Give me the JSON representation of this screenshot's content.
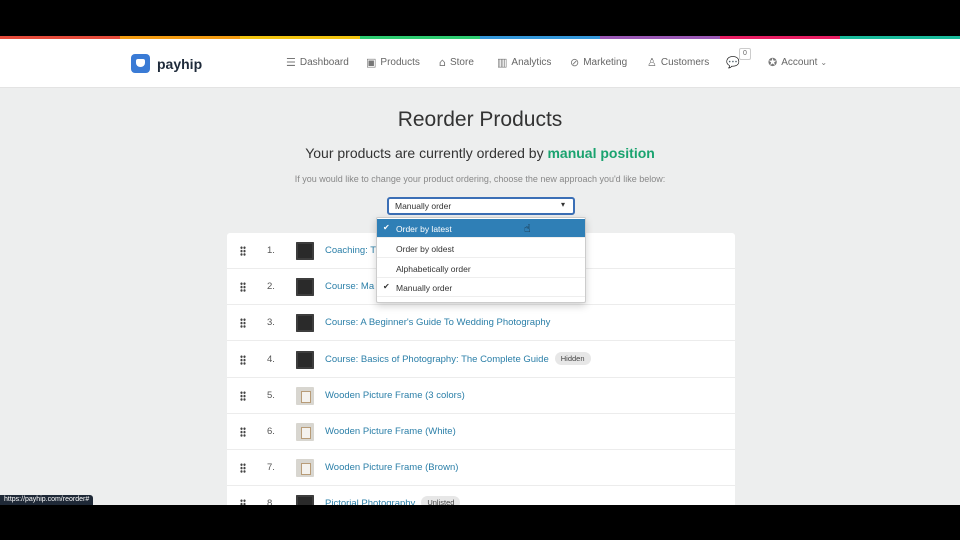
{
  "brand": {
    "name": "payhip",
    "logo_color": "#3a7bd5"
  },
  "accent_colors": [
    "#e74c3c",
    "#f39c12",
    "#f1c40f",
    "#2ecc71",
    "#3498db",
    "#9b59b6",
    "#e91e63",
    "#1abc9c"
  ],
  "nav": {
    "items": [
      {
        "label": "Dashboard",
        "icon": "menu-icon"
      },
      {
        "label": "Products",
        "icon": "box-icon"
      },
      {
        "label": "Store",
        "icon": "store-icon"
      },
      {
        "label": "Analytics",
        "icon": "chart-icon"
      },
      {
        "label": "Marketing",
        "icon": "tag-icon"
      },
      {
        "label": "Customers",
        "icon": "user-icon"
      }
    ],
    "notifications_count": "0",
    "account_label": "Account"
  },
  "page": {
    "title": "Reorder Products",
    "subtitle_prefix": "Your products are currently ordered by",
    "subtitle_value": "manual position",
    "hint": "If you would like to change your product ordering, choose the new approach you'd like below:"
  },
  "sort_select": {
    "selected": "Manually order",
    "options": [
      {
        "label": "Order by latest",
        "highlighted": true,
        "checked": true
      },
      {
        "label": "Order by oldest",
        "highlighted": false,
        "checked": false
      },
      {
        "label": "Alphabetically order",
        "highlighted": false,
        "checked": false
      },
      {
        "label": "Manually order",
        "highlighted": false,
        "checked": true
      }
    ]
  },
  "products": [
    {
      "num": "1.",
      "title": "Coaching: T",
      "thumb": "dark",
      "badge": ""
    },
    {
      "num": "2.",
      "title": "Course: Ma",
      "thumb": "dark",
      "badge": ""
    },
    {
      "num": "3.",
      "title": "Course: A Beginner's Guide To Wedding Photography",
      "thumb": "dark",
      "badge": ""
    },
    {
      "num": "4.",
      "title": "Course: Basics of Photography: The Complete Guide",
      "thumb": "dark",
      "badge": "Hidden"
    },
    {
      "num": "5.",
      "title": "Wooden Picture Frame (3 colors)",
      "thumb": "light",
      "badge": ""
    },
    {
      "num": "6.",
      "title": "Wooden Picture Frame (White)",
      "thumb": "light",
      "badge": ""
    },
    {
      "num": "7.",
      "title": "Wooden Picture Frame (Brown)",
      "thumb": "light",
      "badge": ""
    },
    {
      "num": "8.",
      "title": "Pictorial Photography",
      "thumb": "dark",
      "badge": "Unlisted"
    }
  ],
  "status_url": "https://payhip.com/reorder#"
}
